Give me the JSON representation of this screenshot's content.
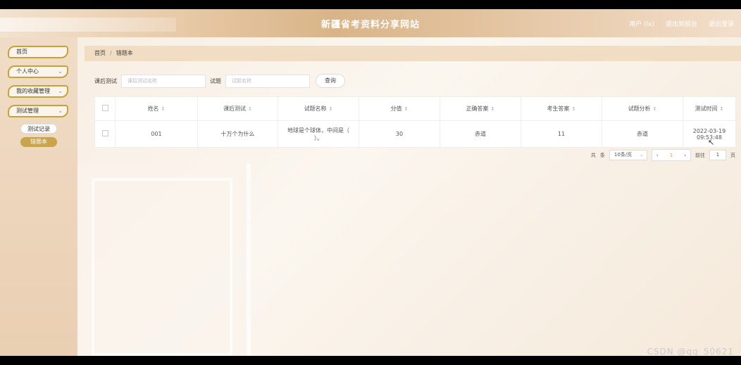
{
  "header": {
    "title": "新疆省考资料分享网站",
    "links": [
      "用户 (lx)",
      "退出到前台",
      "退出登录"
    ]
  },
  "sidebar": {
    "items": [
      {
        "label": "首页",
        "has_chevron": false
      },
      {
        "label": "个人中心",
        "has_chevron": true
      },
      {
        "label": "我的收藏管理",
        "has_chevron": true
      },
      {
        "label": "测试管理",
        "has_chevron": true
      }
    ],
    "sub_items": [
      "测试记录",
      "错题本"
    ]
  },
  "breadcrumb": {
    "home": "首页",
    "sep": "/",
    "current": "错题本"
  },
  "search": {
    "label1": "课后测试",
    "placeholder1": "课后测试名称",
    "label2": "试题",
    "placeholder2": "试题名称",
    "button": "查询"
  },
  "table": {
    "headers": [
      "姓名",
      "课后测试",
      "试题名称",
      "分值",
      "正确答案",
      "考生答案",
      "试题分析",
      "测试时间"
    ],
    "sort_icon": "↕",
    "rows": [
      {
        "name": "001",
        "test": "十万个为什么",
        "question": "地球是个球体，中间是（ ）。",
        "score": "30",
        "correct": "赤道",
        "answer": "11",
        "analysis": "赤道",
        "time": "2022-03-19 09:53:48"
      }
    ]
  },
  "pager": {
    "total_prefix": "共",
    "total_suffix": "条",
    "page_size": "10条/页",
    "prev": "‹",
    "current": "1",
    "next": "›",
    "goto": "前往",
    "goto_value": "1",
    "page_unit": "页"
  },
  "watermark": "CSDN @qq_50621"
}
